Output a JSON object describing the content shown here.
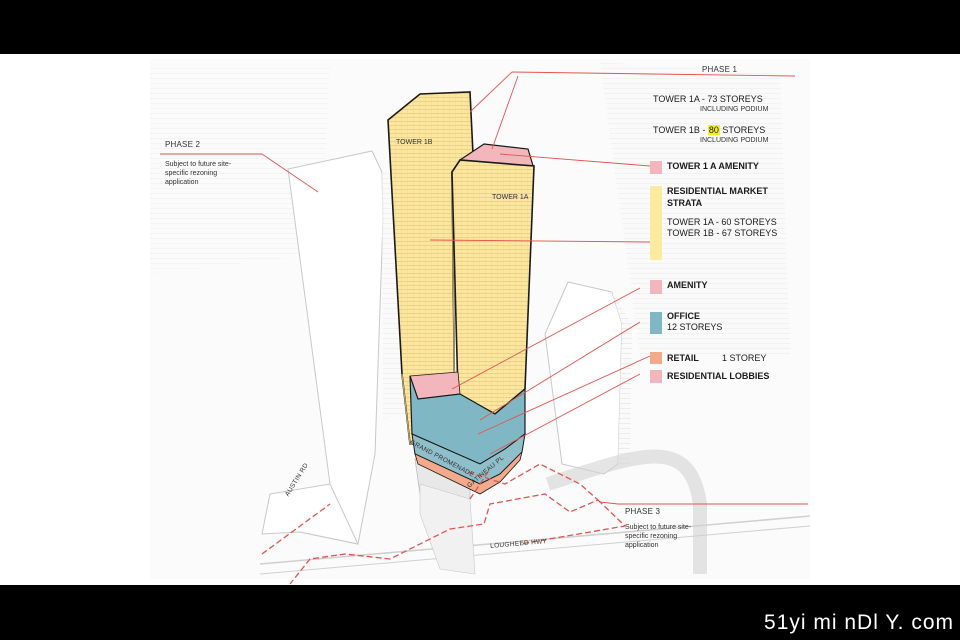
{
  "phase1": {
    "title": "PHASE 1",
    "tower1a_prefix": "TOWER 1A - 73 STOREYS",
    "tower1a_sub": "INCLUDING PODIUM",
    "tower1b_prefix": "TOWER 1B - ",
    "tower1b_highlight": "80",
    "tower1b_suffix": " STOREYS",
    "tower1b_sub": "INCLUDING PODIUM"
  },
  "phase2": {
    "title": "PHASE 2",
    "note": "Subject to future site-specific rezoning application"
  },
  "phase3": {
    "title": "PHASE 3",
    "note": "Subject to future site-specific rezoning application"
  },
  "towers": {
    "t1b": "TOWER 1B",
    "t1a": "TOWER 1A"
  },
  "roads": {
    "austin": "AUSTIN RD",
    "grand": "GRAND PROMENADE",
    "gatineau": "GATINEAU PL",
    "lougheed": "LOUGHEED HWY"
  },
  "legend": [
    {
      "key": "amenity1a",
      "title": "TOWER 1 A AMENITY",
      "color": "#f4b6bd"
    },
    {
      "key": "residential",
      "title": "RESIDENTIAL MARKET STRATA",
      "line1": "TOWER 1A - 60 STOREYS",
      "line2": "TOWER 1B - 67 STOREYS",
      "color": "#fbeb9e"
    },
    {
      "key": "amenity",
      "title": "AMENITY",
      "color": "#f4b6bd"
    },
    {
      "key": "office",
      "title": "OFFICE",
      "detail": "12 STOREYS",
      "color": "#7fb8c4"
    },
    {
      "key": "retail",
      "title": "RETAIL",
      "detail": "1 STOREY",
      "color": "#f3a98c"
    },
    {
      "key": "lobbies",
      "title": "RESIDENTIAL LOBBIES",
      "color": "#f4b6bd"
    }
  ],
  "colors": {
    "leader_line": "#e2554e",
    "site_boundary": "#e2554e",
    "outline": "#1a1a1a"
  },
  "watermark": "51yi mi nDl Y. com"
}
